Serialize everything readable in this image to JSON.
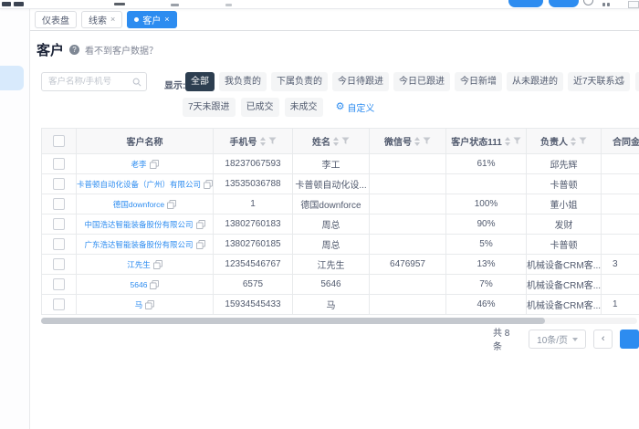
{
  "icons": {
    "close": "×",
    "prev_arrow": "‹",
    "gear": "⚙",
    "help": "?"
  },
  "tabs": {
    "items": [
      {
        "label": "仪表盘",
        "active": false,
        "closable": false
      },
      {
        "label": "线索",
        "active": false,
        "closable": true
      },
      {
        "label": "客户",
        "active": true,
        "closable": true
      }
    ]
  },
  "page": {
    "title": "客户",
    "help_link": "看不到客户数据？"
  },
  "search": {
    "placeholder": "客户名称/手机号"
  },
  "filters": {
    "display_label": "显示:",
    "active": "全部",
    "row1": [
      "全部",
      "我负责的",
      "下属负责的",
      "今日待跟进",
      "今日已跟进",
      "今日新增",
      "从未跟进的",
      "近7天联系过"
    ],
    "row2": [
      "7天未跟进",
      "已成交",
      "未成交"
    ],
    "customize_label": "自定义"
  },
  "table": {
    "columns": [
      {
        "label": "客户名称",
        "sortable": false,
        "filterable": false
      },
      {
        "label": "手机号",
        "sortable": true,
        "filterable": true
      },
      {
        "label": "姓名",
        "sortable": true,
        "filterable": true
      },
      {
        "label": "微信号",
        "sortable": true,
        "filterable": true
      },
      {
        "label": "客户状态111",
        "sortable": true,
        "filterable": true
      },
      {
        "label": "负责人",
        "sortable": true,
        "filterable": true
      },
      {
        "label": "合同金额",
        "sortable": false,
        "filterable": false
      }
    ],
    "rows": [
      {
        "name": "老李",
        "phone": "18237067593",
        "contact": "李工",
        "wechat": "",
        "status": "61%",
        "owner": "邱先辉",
        "contract": ""
      },
      {
        "name": "卡普顿自动化设备（广州）有限公司",
        "phone": "13535036788",
        "contact": "卡普顿自动化设...",
        "wechat": "",
        "status": "",
        "owner": "卡普顿",
        "contract": ""
      },
      {
        "name": "德国downforce",
        "phone": "1",
        "contact": "德国downforce",
        "wechat": "",
        "status": "100%",
        "owner": "董小姐",
        "contract": ""
      },
      {
        "name": "中国浩达智能装备股份有限公司",
        "phone": "13802760183",
        "contact": "周总",
        "wechat": "",
        "status": "90%",
        "owner": "发财",
        "contract": ""
      },
      {
        "name": "广东浩达智能装备股份有限公司",
        "phone": "13802760185",
        "contact": "周总",
        "wechat": "",
        "status": "5%",
        "owner": "卡普顿",
        "contract": ""
      },
      {
        "name": "江先生",
        "phone": "12354546767",
        "contact": "江先生",
        "wechat": "6476957",
        "status": "13%",
        "owner": "机械设备CRM客...",
        "contract": "3"
      },
      {
        "name": "5646",
        "phone": "6575",
        "contact": "5646",
        "wechat": "",
        "status": "7%",
        "owner": "机械设备CRM客...",
        "contract": ""
      },
      {
        "name": "马",
        "phone": "15934545433",
        "contact": "马",
        "wechat": "",
        "status": "46%",
        "owner": "机械设备CRM客...",
        "contract": "1"
      }
    ]
  },
  "pagination": {
    "total": "共 8 条",
    "page_size": "10条/页"
  }
}
